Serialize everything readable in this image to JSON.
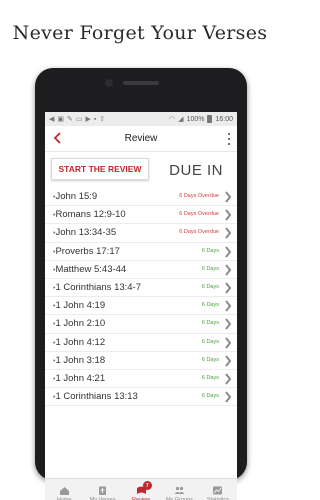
{
  "promo": {
    "title": "Never Forget Your Verses"
  },
  "status_bar": {
    "battery": "100%",
    "time": "16:00"
  },
  "app_bar": {
    "title": "Review"
  },
  "review": {
    "start_button": "START THE REVIEW",
    "due_header": "DUE IN"
  },
  "verses": [
    {
      "ref": "John 15:9",
      "due": "6 Days Overdue",
      "status": "overdue"
    },
    {
      "ref": "Romans 12:9-10",
      "due": "6 Days Overdue",
      "status": "overdue"
    },
    {
      "ref": "John 13:34-35",
      "due": "6 Days Overdue",
      "status": "overdue"
    },
    {
      "ref": "Proverbs 17:17",
      "due": "6 Days",
      "status": "ontime"
    },
    {
      "ref": "Matthew 5:43-44",
      "due": "6 Days",
      "status": "ontime"
    },
    {
      "ref": "1 Corinthians 13:4-7",
      "due": "6 Days",
      "status": "ontime"
    },
    {
      "ref": "1 John 4:19",
      "due": "6 Days",
      "status": "ontime"
    },
    {
      "ref": "1 John 2:10",
      "due": "6 Days",
      "status": "ontime"
    },
    {
      "ref": "1 John 4:12",
      "due": "6 Days",
      "status": "ontime"
    },
    {
      "ref": "1 John 3:18",
      "due": "6 Days",
      "status": "ontime"
    },
    {
      "ref": "1 John 4:21",
      "due": "6 Days",
      "status": "ontime"
    },
    {
      "ref": "1 Corinthians 13:13",
      "due": "6 Days",
      "status": "ontime"
    }
  ],
  "bottom_nav": [
    {
      "label": "Home",
      "icon": "home-icon",
      "active": false
    },
    {
      "label": "My Verses",
      "icon": "bible-icon",
      "active": false
    },
    {
      "label": "Review",
      "icon": "review-icon",
      "active": true,
      "badge": "7"
    },
    {
      "label": "My Groups",
      "icon": "groups-icon",
      "active": false
    },
    {
      "label": "Statistics",
      "icon": "chart-icon",
      "active": false
    }
  ],
  "colors": {
    "accent": "#c0282d",
    "overdue": "#d23a3a",
    "ontime": "#4a9a3a"
  }
}
